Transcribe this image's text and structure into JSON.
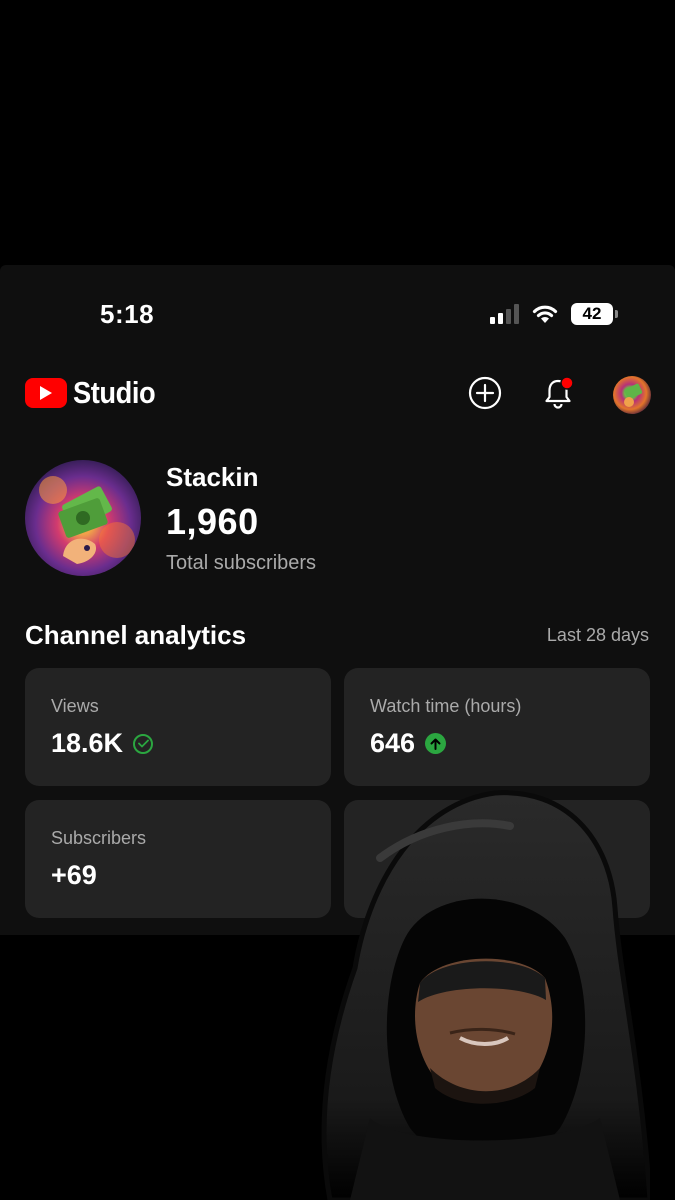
{
  "status_bar": {
    "time": "5:18",
    "battery": "42"
  },
  "header": {
    "app_name": "Studio",
    "icons": [
      "create-icon",
      "notification-bell-icon",
      "account-avatar"
    ],
    "notification_dot_color": "#ff0000"
  },
  "channel": {
    "name": "Stackin",
    "subscriber_count": "1,960",
    "subscriber_label": "Total subscribers"
  },
  "analytics": {
    "title": "Channel analytics",
    "period": "Last 28 days",
    "cards": [
      {
        "label": "Views",
        "value": "18.6K",
        "indicator": "check-circle-icon"
      },
      {
        "label": "Watch time (hours)",
        "value": "646",
        "indicator": "arrow-up-circle-icon"
      },
      {
        "label": "Subscribers",
        "value": "+69"
      }
    ]
  },
  "colors": {
    "background": "#0f0f0f",
    "card": "#232323",
    "brand_red": "#ff0000",
    "positive_green": "#2ba640",
    "muted_text": "#aaaaaa"
  }
}
